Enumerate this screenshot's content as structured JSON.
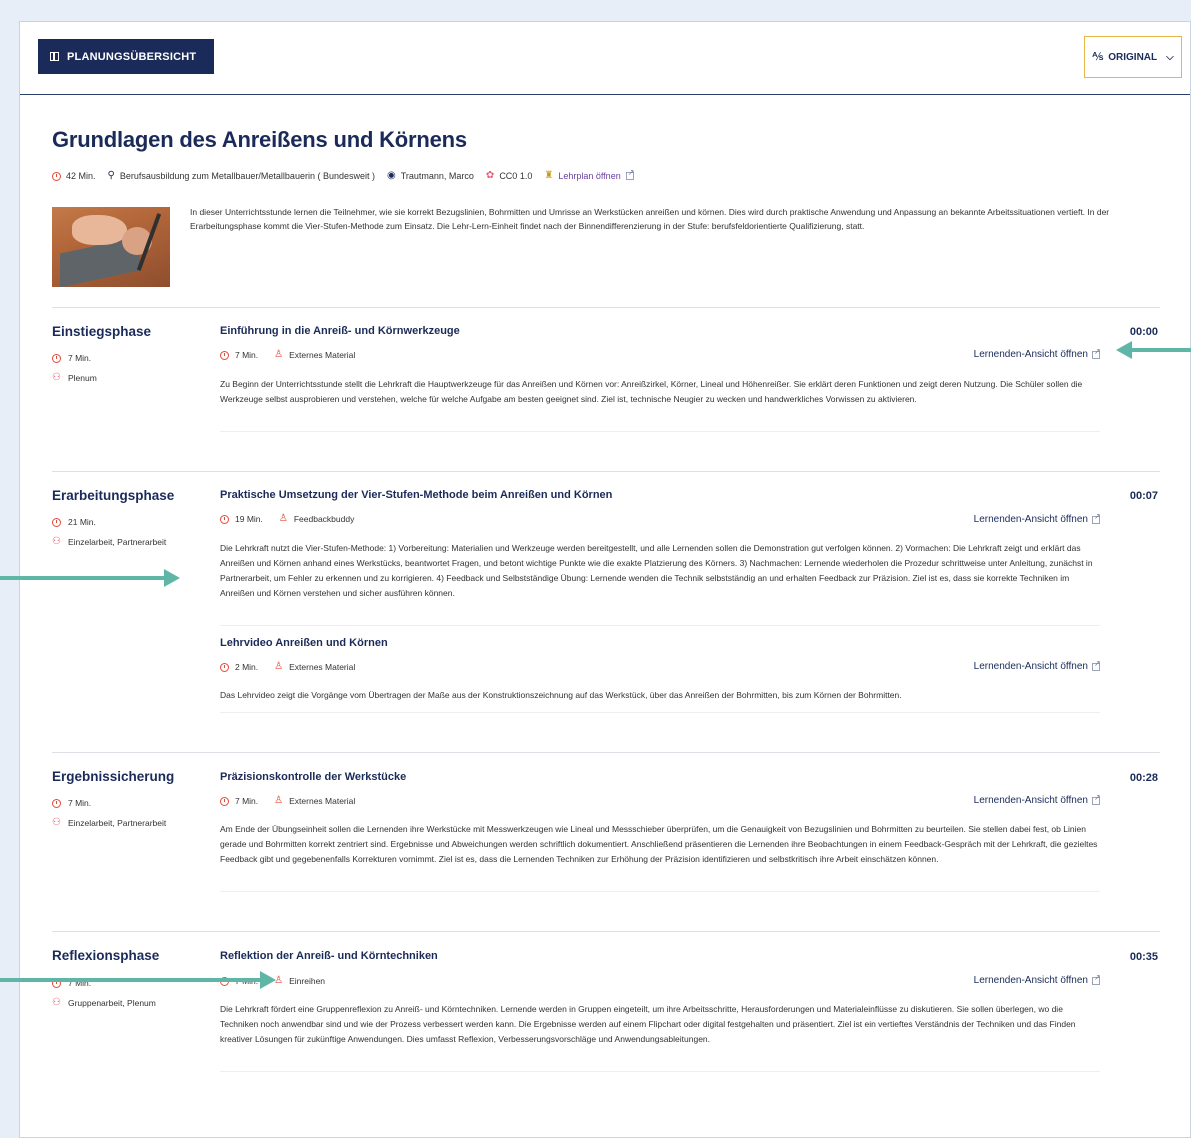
{
  "header": {
    "plan_button_label": "PLANUNGSÜBERSICHT",
    "language_button_label": "ORIGINAL",
    "language_icon": "translate-icon"
  },
  "lesson": {
    "title": "Grundlagen des Anreißens und Körnens",
    "duration": "42 Min.",
    "program": "Berufsausbildung zum Metallbauer/Metallbauerin ( Bundesweit )",
    "author": "Trautmann, Marco",
    "license": "CC0 1.0",
    "curriculum_link": "Lehrplan öffnen",
    "intro": "In dieser Unterrichtsstunde lernen die Teilnehmer, wie sie korrekt Bezugslinien, Bohrmitten und Umrisse an Werkstücken anreißen und körnen. Dies wird durch praktische Anwendung und Anpassung an bekannte Arbeitssituationen vertieft. In der Erarbeitungsphase kommt die Vier-Stufen-Methode zum Einsatz. Die Lehr-Lern-Einheit findet nach der Binnendifferenzierung in der Stufe: berufsfeldorientierte Qualifizierung, statt."
  },
  "open_label": "Lernenden-Ansicht öffnen",
  "phases": [
    {
      "name": "Einstiegsphase",
      "duration": "7 Min.",
      "social_form": "Plenum",
      "time": "00:00",
      "activities": [
        {
          "title": "Einführung in die Anreiß- und Körnwerkzeuge",
          "duration": "7 Min.",
          "material": "Externes Material",
          "description": "Zu Beginn der Unterrichtsstunde stellt die Lehrkraft die Hauptwerkzeuge für das Anreißen und Körnen vor: Anreißzirkel, Körner, Lineal und Höhenreißer. Sie erklärt deren Funktionen und zeigt deren Nutzung. Die Schüler sollen die Werkzeuge selbst ausprobieren und verstehen, welche für welche Aufgabe am besten geeignet sind. Ziel ist, technische Neugier zu wecken und handwerkliches Vorwissen zu aktivieren."
        }
      ]
    },
    {
      "name": "Erarbeitungsphase",
      "duration": "21 Min.",
      "social_form": "Einzelarbeit, Partnerarbeit",
      "time": "00:07",
      "activities": [
        {
          "title": "Praktische Umsetzung der Vier-Stufen-Methode beim Anreißen und Körnen",
          "duration": "19 Min.",
          "material": "Feedbackbuddy",
          "description": "Die Lehrkraft nutzt die Vier-Stufen-Methode: 1) Vorbereitung: Materialien und Werkzeuge werden bereitgestellt, und alle Lernenden sollen die Demonstration gut verfolgen können. 2) Vormachen: Die Lehrkraft zeigt und erklärt das Anreißen und Körnen anhand eines Werkstücks, beantwortet Fragen, und betont wichtige Punkte wie die exakte Platzierung des Körners. 3) Nachmachen: Lernende wiederholen die Prozedur schrittweise unter Anleitung, zunächst in Partnerarbeit, um Fehler zu erkennen und zu korrigieren. 4) Feedback und Selbstständige Übung: Lernende wenden die Technik selbstständig an und erhalten Feedback zur Präzision. Ziel ist es, dass sie korrekte Techniken im Anreißen und Körnen verstehen und sicher ausführen können."
        },
        {
          "title": "Lehrvideo Anreißen und Körnen",
          "duration": "2 Min.",
          "material": "Externes Material",
          "description": "Das Lehrvideo zeigt die Vorgänge vom Übertragen der Maße aus der Konstruktionszeichnung auf das Werkstück, über das Anreißen der Bohrmitten, bis zum Körnen der Bohrmitten."
        }
      ]
    },
    {
      "name": "Ergebnissicherung",
      "duration": "7 Min.",
      "social_form": "Einzelarbeit, Partnerarbeit",
      "time": "00:28",
      "activities": [
        {
          "title": "Präzisionskontrolle der Werkstücke",
          "duration": "7 Min.",
          "material": "Externes Material",
          "description": "Am Ende der Übungseinheit sollen die Lernenden ihre Werkstücke mit Messwerkzeugen wie Lineal und Messschieber überprüfen, um die Genauigkeit von Bezugslinien und Bohrmitten zu beurteilen. Sie stellen dabei fest, ob Linien gerade und Bohrmitten korrekt zentriert sind. Ergebnisse und Abweichungen werden schriftlich dokumentiert. Anschließend präsentieren die Lernenden ihre Beobachtungen in einem Feedback-Gespräch mit der Lehrkraft, die gezieltes Feedback gibt und gegebenenfalls Korrekturen vornimmt. Ziel ist es, dass die Lernenden Techniken zur Erhöhung der Präzision identifizieren und selbstkritisch ihre Arbeit einschätzen können."
        }
      ]
    },
    {
      "name": "Reflexionsphase",
      "duration": "7 Min.",
      "social_form": "Gruppenarbeit, Plenum",
      "time": "00:35",
      "activities": [
        {
          "title": "Reflektion der Anreiß- und Körntechniken",
          "duration": "7 Min.",
          "material": "Einreihen",
          "description": "Die Lehrkraft fördert eine Gruppenreflexion zu Anreiß- und Körntechniken. Lernende werden in Gruppen eingeteilt, um ihre Arbeitsschritte, Herausforderungen und Materialeinflüsse zu diskutieren. Sie sollen überlegen, wo die Techniken noch anwendbar sind und wie der Prozess verbessert werden kann. Die Ergebnisse werden auf einem Flipchart oder digital festgehalten und präsentiert. Ziel ist ein vertieftes Verständnis der Techniken und das Finden kreativer Lösungen für zukünftige Anwendungen. Dies umfasst Reflexion, Verbesserungsvorschläge und Anwendungsableitungen."
        }
      ]
    }
  ],
  "colors": {
    "navy": "#1b2b59",
    "accent_red": "#e04a3a",
    "accent_pink": "#e6607a",
    "link_purple": "#6b3fa0",
    "arrow_teal": "#5fb5a6",
    "border_gold": "#e6b64a"
  }
}
